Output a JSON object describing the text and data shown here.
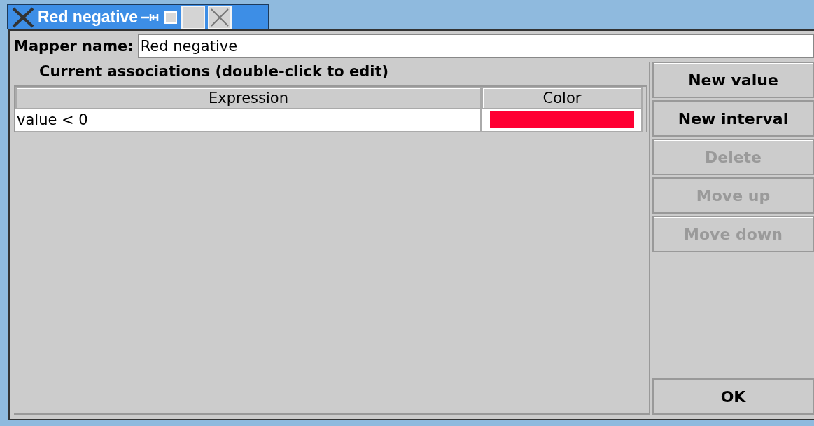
{
  "window": {
    "title": "Red negative"
  },
  "mapper_name": {
    "label": "Mapper name:",
    "value": "Red negative"
  },
  "associations": {
    "caption": "Current associations (double-click to edit)",
    "columns": [
      "Expression",
      "Color"
    ],
    "rows": [
      {
        "expression": "value < 0",
        "color": "#ff0033"
      }
    ]
  },
  "buttons": [
    {
      "label": "New value",
      "disabled": false
    },
    {
      "label": "New interval",
      "disabled": false
    },
    {
      "label": "Delete",
      "disabled": true
    },
    {
      "label": "Move up",
      "disabled": true
    },
    {
      "label": "Move down",
      "disabled": true
    }
  ],
  "ok_button": {
    "label": "OK"
  }
}
